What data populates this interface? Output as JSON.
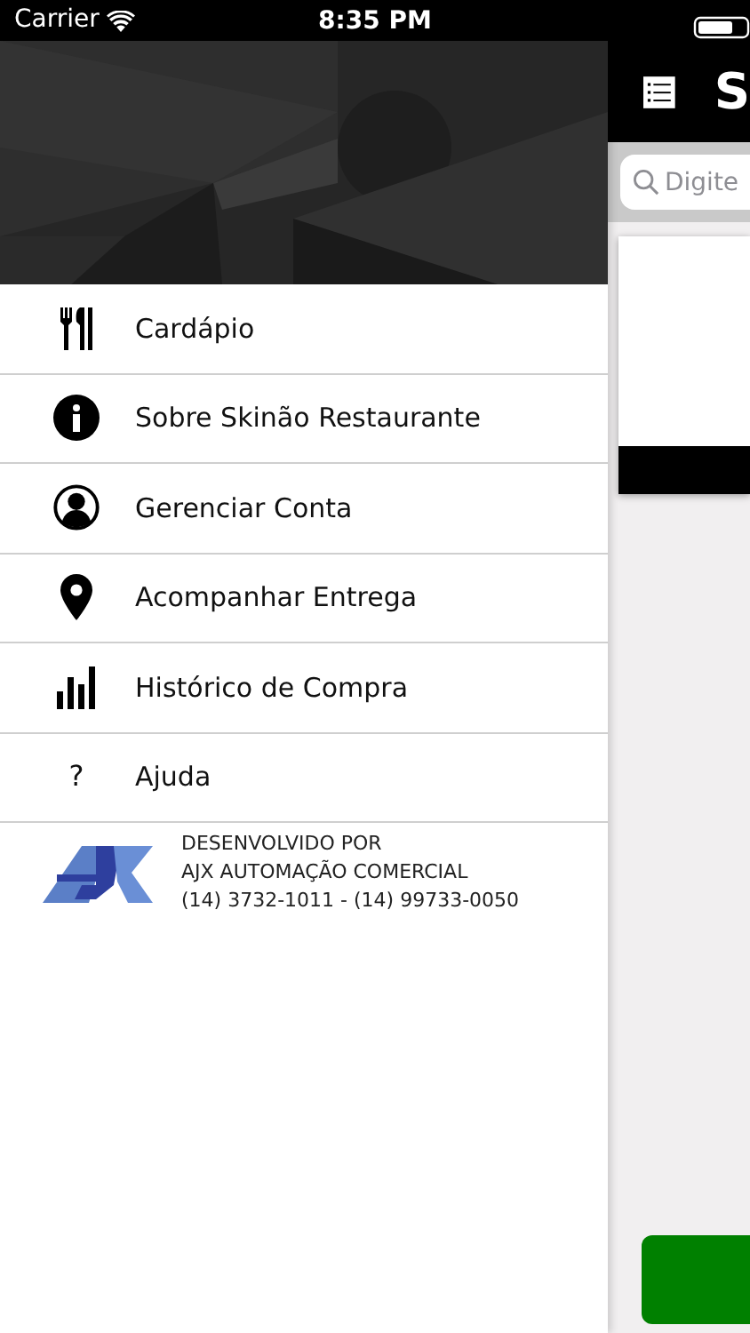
{
  "status_bar": {
    "carrier": "Carrier",
    "time": "8:35 PM"
  },
  "drawer": {
    "items": [
      {
        "kind": "cutlery",
        "label": "Cardápio"
      },
      {
        "kind": "info",
        "label": "Sobre Skinão Restaurante"
      },
      {
        "kind": "person",
        "label": "Gerenciar Conta"
      },
      {
        "kind": "pin",
        "label": "Acompanhar Entrega"
      },
      {
        "kind": "chart",
        "label": "Histórico de Compra"
      },
      {
        "kind": "glyph",
        "glyph": "?",
        "label": "Ajuda"
      }
    ],
    "footer": {
      "lines": [
        "DESENVOLVIDO POR",
        "AJX AUTOMAÇÃO COMERCIAL",
        "(14) 3732-1011 - (14) 99733-0050"
      ]
    }
  },
  "main": {
    "title": "S",
    "search": {
      "placeholder": "Digite"
    }
  }
}
